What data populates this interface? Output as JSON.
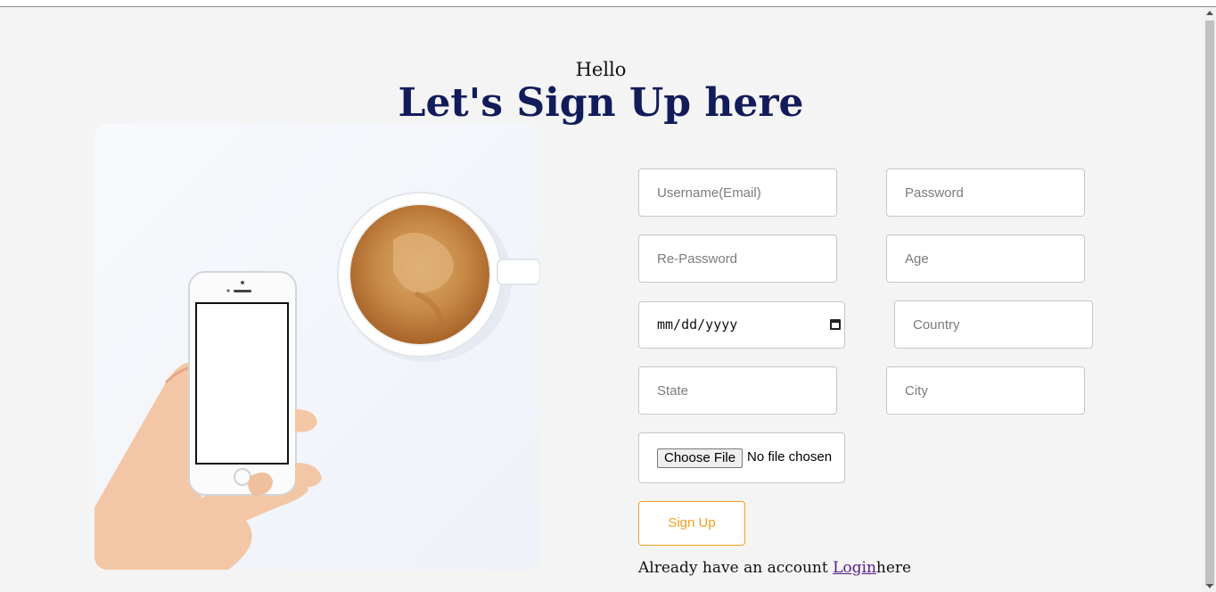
{
  "header": {
    "greeting": "Hello",
    "title": "Let's Sign Up here"
  },
  "form": {
    "username_placeholder": "Username(Email)",
    "password_placeholder": "Password",
    "repassword_placeholder": "Re-Password",
    "age_placeholder": "Age",
    "dob_value": "mm/dd/yyyy",
    "country_placeholder": "Country",
    "state_placeholder": "State",
    "city_placeholder": "City",
    "file_button_label": "Choose File",
    "file_status": "No file chosen",
    "submit_label": "Sign Up"
  },
  "footer": {
    "prefix": "Already have an account ",
    "login_link": "Login",
    "suffix": "here"
  },
  "colors": {
    "background": "#f4f4f4",
    "title": "#131c5a",
    "accent": "#f0a020",
    "link": "#551a8b"
  }
}
